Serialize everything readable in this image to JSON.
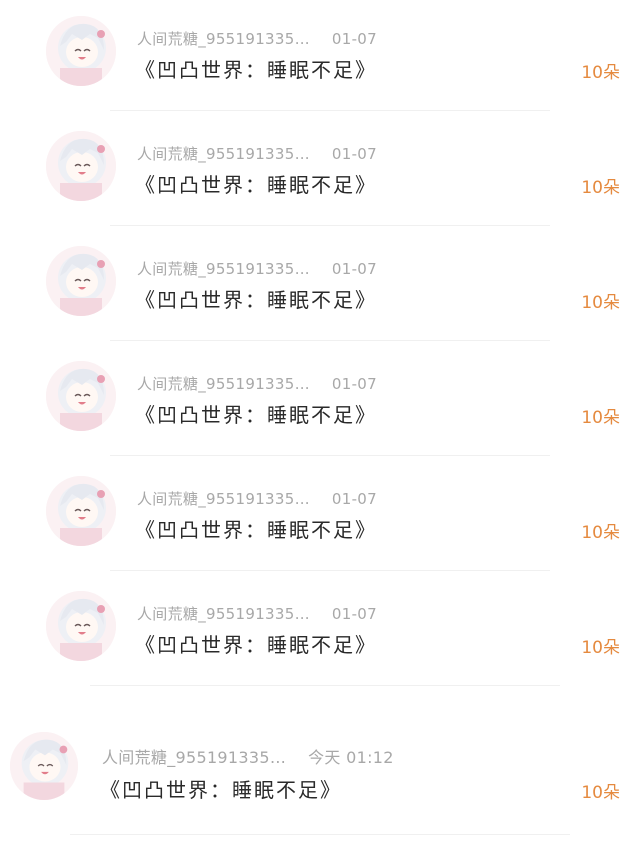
{
  "records": [
    {
      "name": "人间荒糖_955191335…",
      "time": "01-07",
      "content": "《凹凸世界：睡眠不足》",
      "amount": "10朵"
    },
    {
      "name": "人间荒糖_955191335…",
      "time": "01-07",
      "content": "《凹凸世界：睡眠不足》",
      "amount": "10朵"
    },
    {
      "name": "人间荒糖_955191335…",
      "time": "01-07",
      "content": "《凹凸世界：睡眠不足》",
      "amount": "10朵"
    },
    {
      "name": "人间荒糖_955191335…",
      "time": "01-07",
      "content": "《凹凸世界：睡眠不足》",
      "amount": "10朵"
    },
    {
      "name": "人间荒糖_955191335…",
      "time": "01-07",
      "content": "《凹凸世界：睡眠不足》",
      "amount": "10朵"
    },
    {
      "name": "人间荒糖_955191335…",
      "time": "01-07",
      "content": "《凹凸世界：睡眠不足》",
      "amount": "10朵"
    },
    {
      "name": "人间荒糖_955191335…",
      "time": "今天 01:12",
      "content": "《凹凸世界：睡眠不足》",
      "amount": "10朵"
    }
  ],
  "colors": {
    "amount": "#e58a3f",
    "name": "#a8a8a8",
    "content": "#2a2a2a"
  }
}
